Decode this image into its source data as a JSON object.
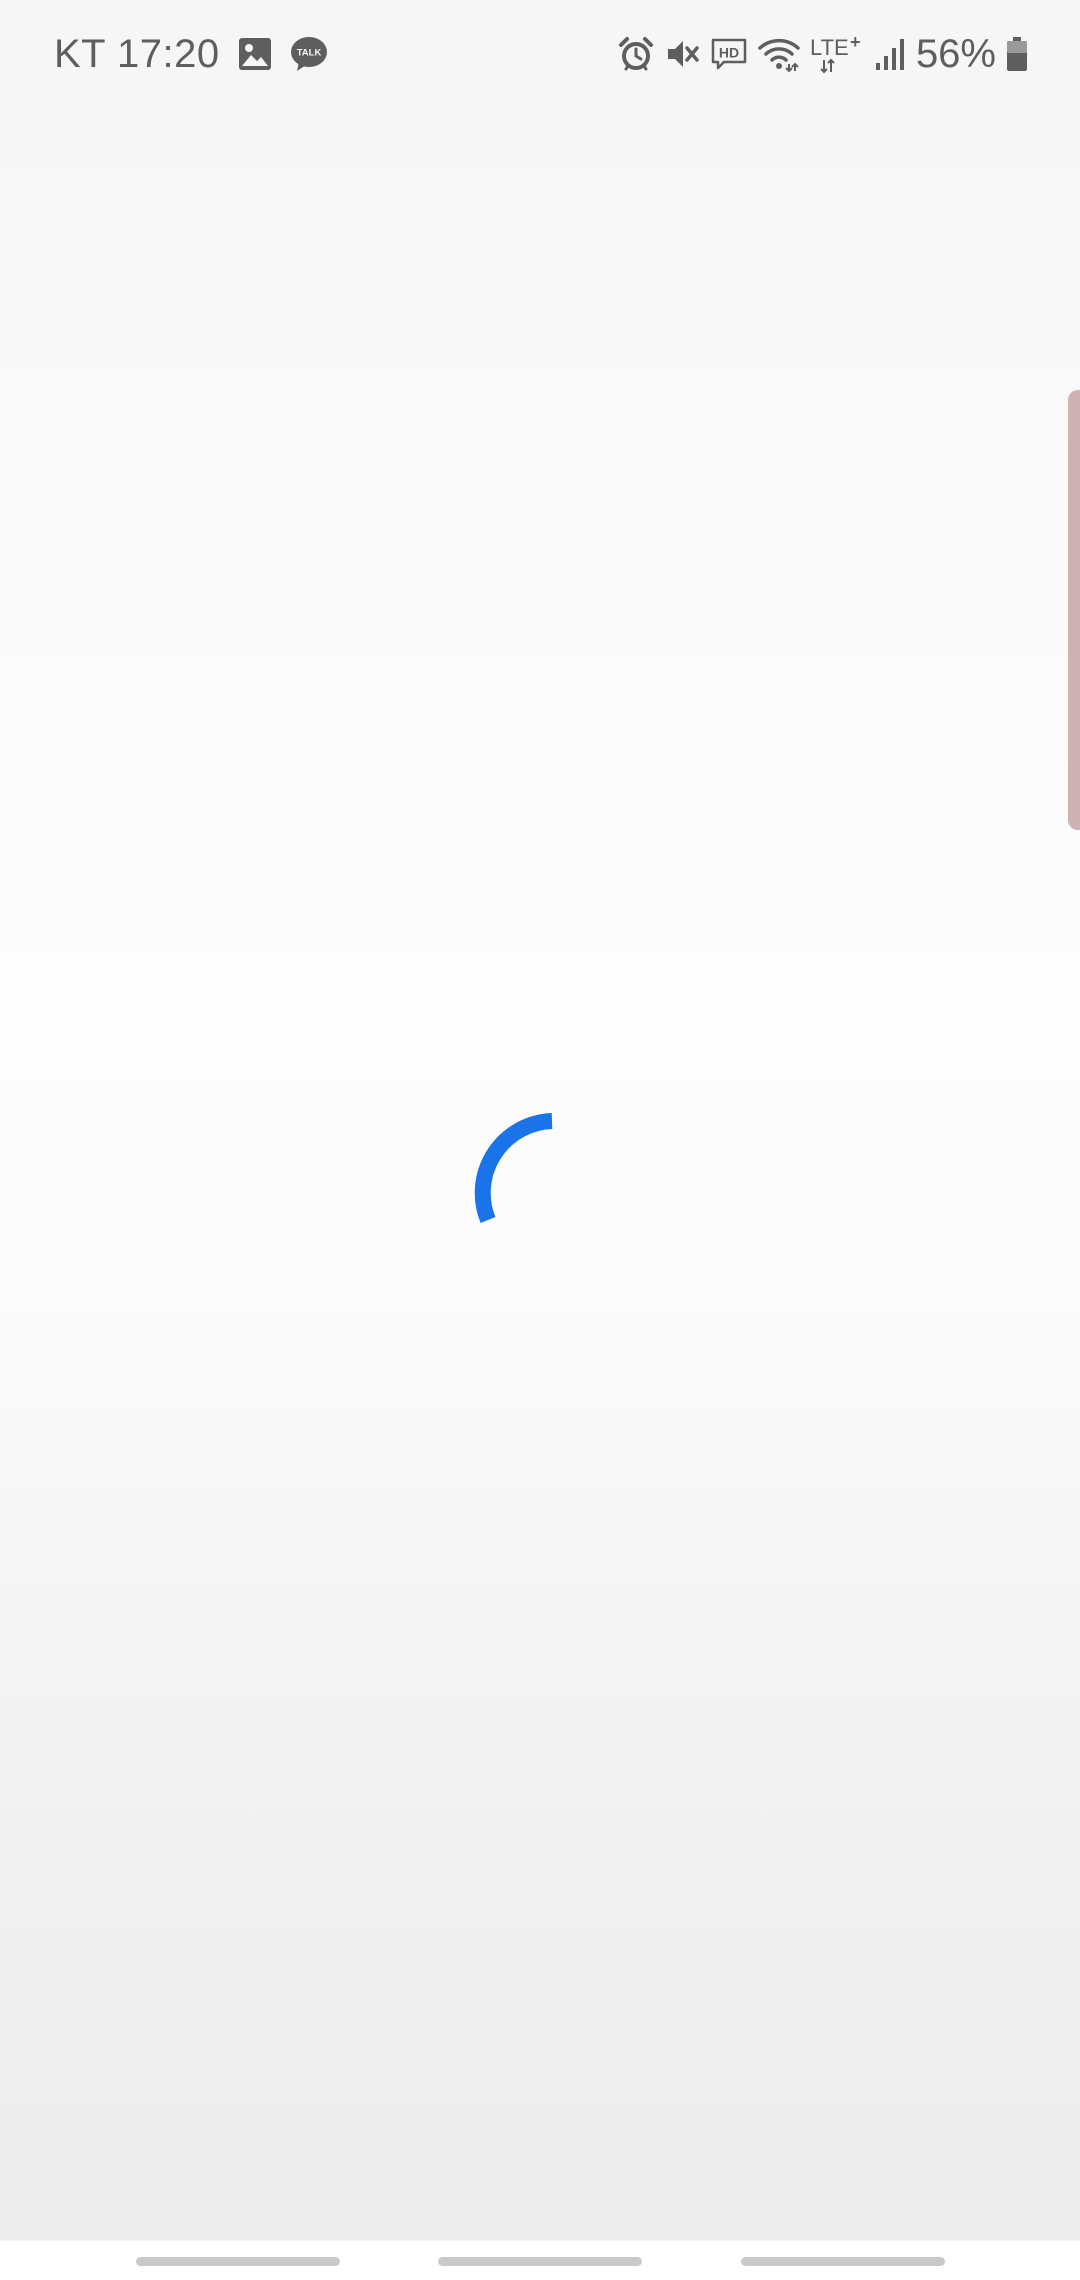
{
  "status_bar": {
    "carrier_time": "KT 17:20",
    "battery_percent": "56%",
    "left_icons": [
      "gallery-icon",
      "kakaotalk-icon"
    ],
    "kakaotalk_badge": "TALK",
    "right_icons": [
      "alarm-icon",
      "mute-icon",
      "hd-voice-icon",
      "wifi-icon",
      "lte-plus-icon",
      "signal-icon",
      "battery-icon"
    ],
    "hd_label": "HD",
    "lte_label": "LTE",
    "lte_plus": "+"
  },
  "main": {
    "loading_indicator": "spinner-icon"
  },
  "colors": {
    "spinner": "#1a73e8",
    "status_icons": "#5e5e5e",
    "edge_handle": "#cdb3b4",
    "nav_pill": "#c9c9c9"
  },
  "nav_bar": {
    "buttons": [
      "recent-apps-button",
      "home-button",
      "back-button"
    ]
  }
}
